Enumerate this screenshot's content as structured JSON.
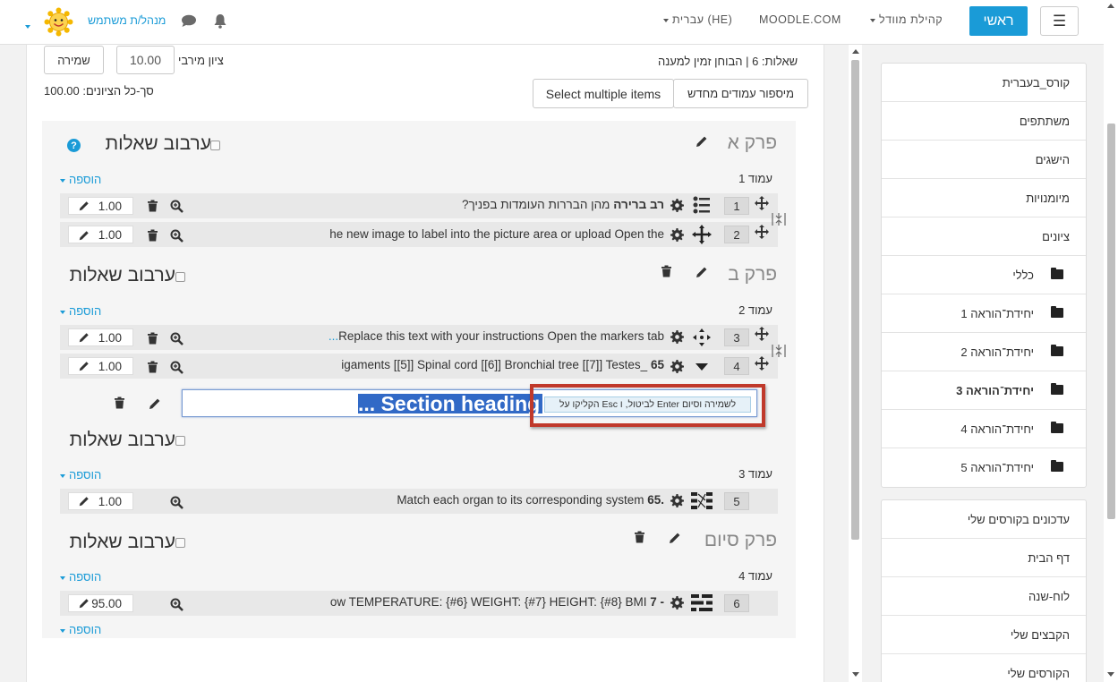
{
  "navbar": {
    "home_label": "ראשי",
    "menu_icon": "☰",
    "community_label": "קהילת מוודל",
    "moodle_label": "MOODLE.COM",
    "language_label": "עברית (HE)",
    "user_name": "מנהל/ת משתמש"
  },
  "quiz": {
    "max_grade_label": "ציון מירבי",
    "max_grade_value": "10.00",
    "save_label": "שמירה",
    "summary": "שאלות: 6 | הבוחן זמין למענה",
    "total_grades": "סך-כל הציונים: 100.00",
    "repaginate_label": "מיספור עמודים מחדש",
    "select_multiple_label": "Select multiple items",
    "shuffle_label": "ערבוב שאלות",
    "add_label": "הוספה"
  },
  "sections": [
    {
      "title": "פרק א",
      "page": "עמוד 1"
    },
    {
      "title": "פרק ב",
      "page": "עמוד 2"
    },
    {
      "page": "עמוד 3"
    },
    {
      "title": "פרק סיום",
      "page": "עמוד 4"
    }
  ],
  "questions": [
    {
      "num": "1",
      "text_bold": "רב ברירה",
      "text": "מהן הבררות העומדות בפניך?",
      "mark": "1.00"
    },
    {
      "num": "2",
      "text": "he new image to label into the picture area or upload Open the",
      "mark": "1.00"
    },
    {
      "num": "3",
      "text": "Replace this text with your instructions Open the markers tab",
      "ellipsis": "...",
      "mark": "1.00"
    },
    {
      "num": "4",
      "text_bold": "65",
      "text": "igaments  [[5]] Spinal cord  [[6]] Bronchial tree  [[7]] Testes_",
      "mark": "1.00"
    },
    {
      "num": "5",
      "text_bold": "65.",
      "text": "Match each organ to its corresponding system",
      "mark": "1.00"
    },
    {
      "num": "6",
      "text_bold": "7 -",
      "text": "ow TEMPERATURE: {#6} WEIGHT: {#7} HEIGHT: {#8} BMI",
      "mark": "95.00"
    }
  ],
  "heading_editor": {
    "value": "... Section heading",
    "tooltip": "הקליקו על Esc לביטול, ו Enter לשמירה וסיום"
  },
  "sidebar": {
    "course_items": [
      {
        "label": "קורס_בעברית"
      },
      {
        "label": "משתתפים"
      },
      {
        "label": "הישגים"
      },
      {
        "label": "מיומנויות"
      },
      {
        "label": "ציונים"
      },
      {
        "label": "כללי",
        "folder": true
      },
      {
        "label": "יחידת־הוראה 1",
        "folder": true
      },
      {
        "label": "יחידת־הוראה 2",
        "folder": true
      },
      {
        "label": "יחידת־הוראה 3",
        "folder": true,
        "bold": true
      },
      {
        "label": "יחידת־הוראה 4",
        "folder": true
      },
      {
        "label": "יחידת־הוראה 5",
        "folder": true
      }
    ],
    "site_items": [
      {
        "label": "עדכונים בקורסים שלי"
      },
      {
        "label": "דף הבית"
      },
      {
        "label": "לוח-שנה"
      },
      {
        "label": "הקבצים שלי"
      },
      {
        "label": "הקורסים שלי"
      }
    ]
  },
  "colors": {
    "accent": "#1a9bd7",
    "highlight_border": "#c0392b"
  }
}
